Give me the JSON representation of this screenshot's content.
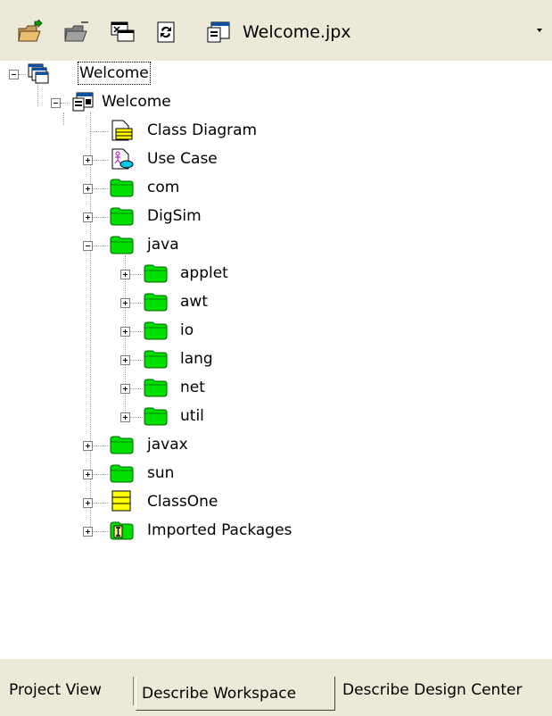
{
  "toolbar": {
    "title": "Welcome.jpx",
    "buttons": [
      {
        "name": "add-files-icon"
      },
      {
        "name": "remove-files-icon"
      },
      {
        "name": "close-project-icon"
      },
      {
        "name": "refresh-icon"
      }
    ],
    "project_icon": "project-file-icon",
    "dropdown_icon": "dropdown-arrow-icon"
  },
  "tree": {
    "items": [
      {
        "label": "Welcome",
        "icon": "project-group-icon",
        "expander": "minus"
      },
      {
        "label": "Welcome",
        "icon": "project-icon",
        "expander": "minus"
      },
      {
        "label": "Class Diagram",
        "icon": "class-diagram-icon",
        "expander": "none"
      },
      {
        "label": "Use Case",
        "icon": "use-case-icon",
        "expander": "plus"
      },
      {
        "label": "com",
        "icon": "package-folder-icon",
        "expander": "plus"
      },
      {
        "label": "DigSim",
        "icon": "package-folder-icon",
        "expander": "plus"
      },
      {
        "label": "java",
        "icon": "package-folder-icon",
        "expander": "minus"
      },
      {
        "label": "applet",
        "icon": "package-folder-icon",
        "expander": "plus"
      },
      {
        "label": "awt",
        "icon": "package-folder-icon",
        "expander": "plus"
      },
      {
        "label": "io",
        "icon": "package-folder-icon",
        "expander": "plus"
      },
      {
        "label": "lang",
        "icon": "package-folder-icon",
        "expander": "plus"
      },
      {
        "label": "net",
        "icon": "package-folder-icon",
        "expander": "plus"
      },
      {
        "label": "util",
        "icon": "package-folder-icon",
        "expander": "plus"
      },
      {
        "label": "javax",
        "icon": "package-folder-icon",
        "expander": "plus"
      },
      {
        "label": "sun",
        "icon": "package-folder-icon",
        "expander": "plus"
      },
      {
        "label": "ClassOne",
        "icon": "class-icon",
        "expander": "plus"
      },
      {
        "label": "Imported Packages",
        "icon": "imported-packages-icon",
        "expander": "plus"
      }
    ]
  },
  "tabs": [
    {
      "label": "Project View",
      "active": false
    },
    {
      "label": "Describe Workspace",
      "active": true
    },
    {
      "label": "Describe Design Center",
      "active": false
    }
  ],
  "colors": {
    "folder_green": "#00e000",
    "chrome": "#ece9d8",
    "class_yellow": "#ffff00"
  }
}
